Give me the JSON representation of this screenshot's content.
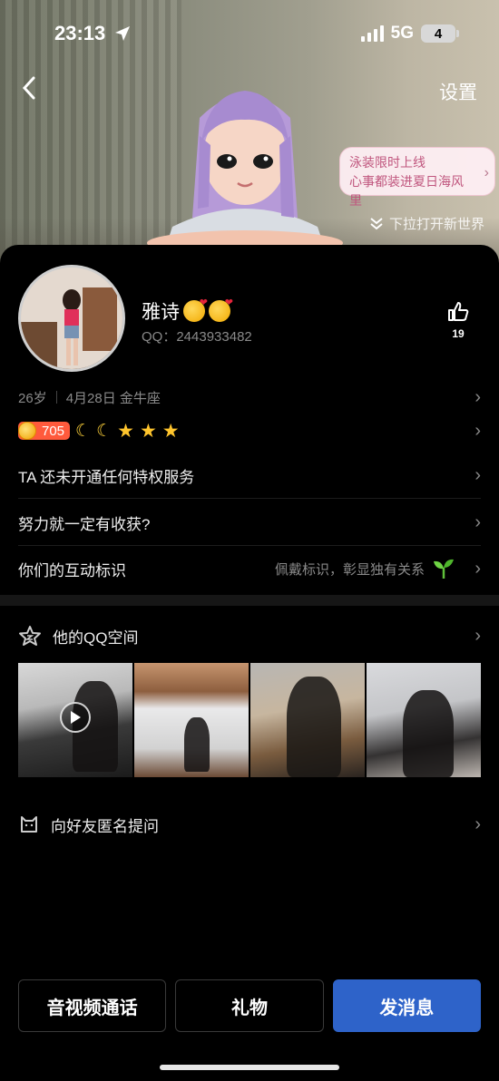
{
  "status_bar": {
    "time": "23:13",
    "network": "5G",
    "battery": "4"
  },
  "header": {
    "settings_label": "设置"
  },
  "promo": {
    "line1": "泳装限时上线",
    "line2": "心事都装进夏日海风里",
    "pulldown_hint": "下拉打开新世界"
  },
  "profile": {
    "name": "雅诗",
    "qq_label": "QQ：2443933482",
    "likes": "19",
    "age": "26岁",
    "birthday": "4月28日 金牛座",
    "level_value": "705"
  },
  "rows": {
    "privilege": "TA 还未开通任何特权服务",
    "signature": "努力就一定有收获?",
    "interaction": "你们的互动标识",
    "interaction_hint": "佩戴标识，彰显独有关系"
  },
  "qzone": {
    "title": "他的QQ空间"
  },
  "ask": {
    "title": "向好友匿名提问"
  },
  "actions": {
    "call": "音视频通话",
    "gift": "礼物",
    "message": "发消息"
  },
  "colors": {
    "primary_button": "#2e63c9",
    "level_badge": "#ff5a3c",
    "star": "#ffc52d"
  }
}
